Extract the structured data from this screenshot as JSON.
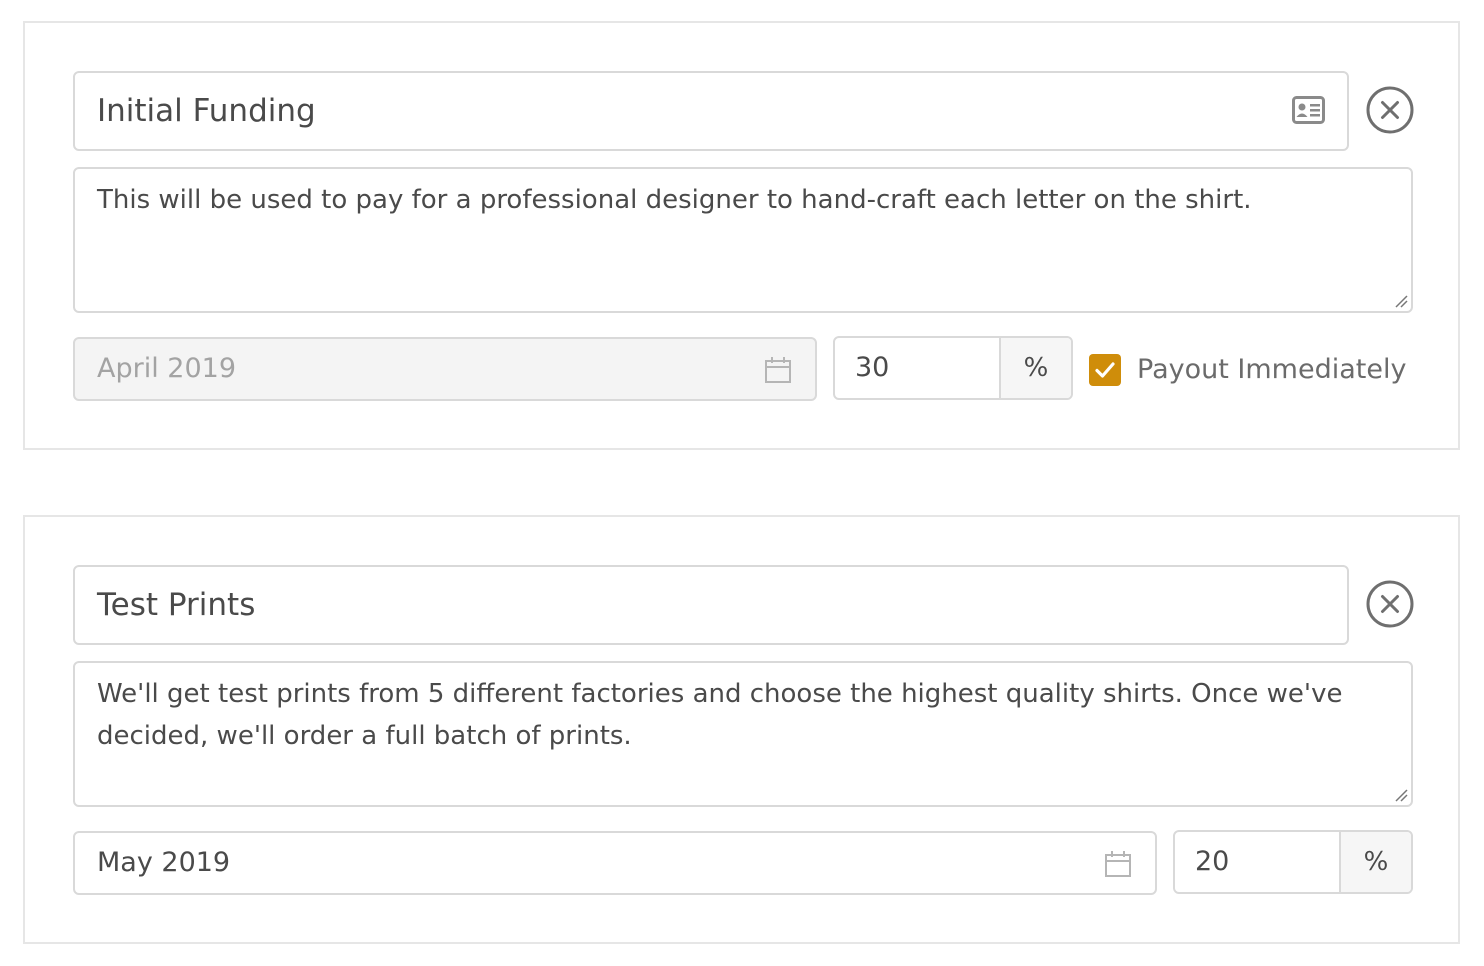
{
  "milestones": [
    {
      "title": "Initial Funding",
      "title_icon": "id-card-icon",
      "description": "This will be used to pay for a professional designer to hand-craft each letter on the shirt.",
      "date": "April 2019",
      "date_disabled": true,
      "percent": "30",
      "percent_symbol": "%",
      "payout_label": "Payout Immediately",
      "payout_checked": true
    },
    {
      "title": "Test Prints",
      "description": "We'll get test prints from 5 different factories and choose the highest quality shirts. Once we've decided, we'll order a full batch of prints.",
      "date": "May 2019",
      "date_disabled": false,
      "percent": "20",
      "percent_symbol": "%"
    }
  ],
  "icons": {
    "remove": "close-circle-icon",
    "calendar": "calendar-icon",
    "checkbox": "check-icon"
  },
  "colors": {
    "accent": "#cf8d0a",
    "border": "#d9d9d9",
    "card_border": "#e6e6e6",
    "text": "#4a4a4a",
    "disabled_bg": "#f4f4f4",
    "disabled_text": "#a3a3a3"
  }
}
